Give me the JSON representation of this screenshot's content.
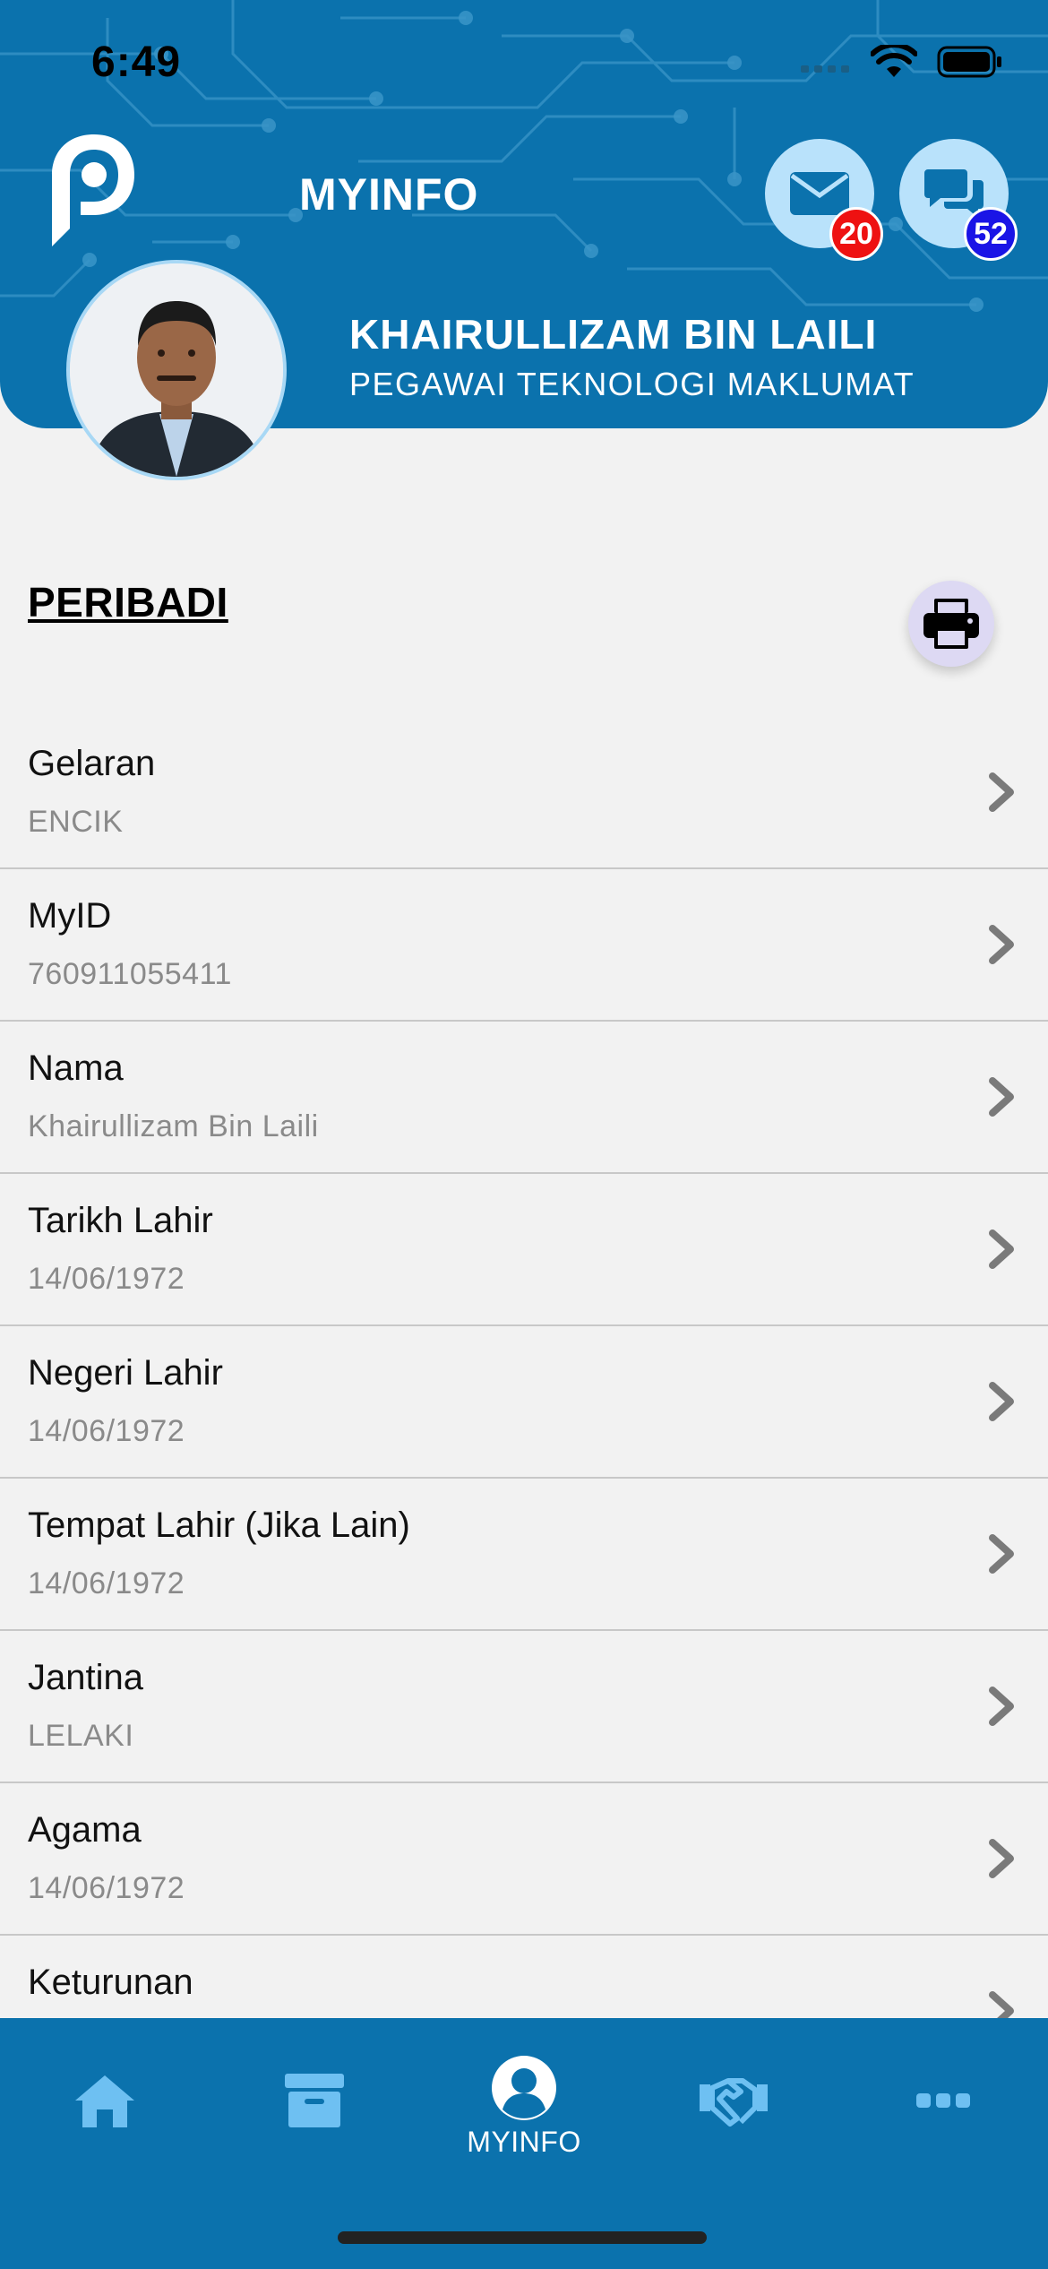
{
  "status_bar": {
    "time": "6:49"
  },
  "header": {
    "title": "MYINFO",
    "mail_count": "20",
    "chat_count": "52",
    "user_name": "KHAIRULLIZAM BIN LAILI",
    "user_role": "PEGAWAI TEKNOLOGI MAKLUMAT",
    "accent_color": "#0b72ad"
  },
  "section": {
    "title": "PERIBADI"
  },
  "fields": [
    {
      "label": "Gelaran",
      "value": "ENCIK"
    },
    {
      "label": "MyID",
      "value": "760911055411"
    },
    {
      "label": "Nama",
      "value": "Khairullizam Bin Laili"
    },
    {
      "label": "Tarikh Lahir",
      "value": "14/06/1972"
    },
    {
      "label": "Negeri Lahir",
      "value": "14/06/1972"
    },
    {
      "label": "Tempat Lahir (Jika Lain)",
      "value": "14/06/1972"
    },
    {
      "label": "Jantina",
      "value": "LELAKI"
    },
    {
      "label": "Agama",
      "value": "14/06/1972"
    },
    {
      "label": "Keturunan",
      "value": ""
    }
  ],
  "tabbar": {
    "active_label": "MYINFO",
    "icons": [
      "home-icon",
      "archive-icon",
      "user-icon",
      "handshake-icon",
      "more-icon"
    ]
  }
}
